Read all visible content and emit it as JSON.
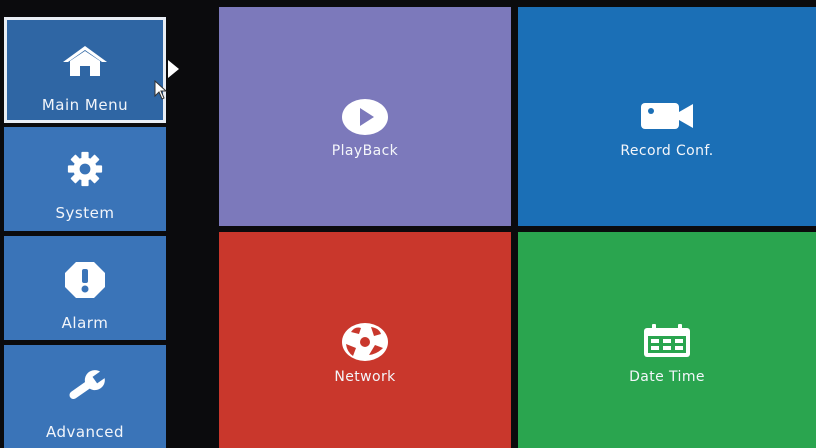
{
  "sidebar": {
    "items": [
      {
        "label": "Main Menu",
        "icon": "home-icon",
        "active": true
      },
      {
        "label": "System",
        "icon": "gear-icon",
        "active": false
      },
      {
        "label": "Alarm",
        "icon": "alert-icon",
        "active": false
      },
      {
        "label": "Advanced",
        "icon": "wrench-icon",
        "active": false
      }
    ]
  },
  "tiles": [
    {
      "label": "PlayBack",
      "icon": "play-icon",
      "color": "#7c79bb"
    },
    {
      "label": "Record Conf.",
      "icon": "camera-icon",
      "color": "#1b6fb6"
    },
    {
      "label": "Network",
      "icon": "network-globe-icon",
      "color": "#c9372c"
    },
    {
      "label": "Date Time",
      "icon": "calendar-icon",
      "color": "#2aa54f"
    }
  ]
}
